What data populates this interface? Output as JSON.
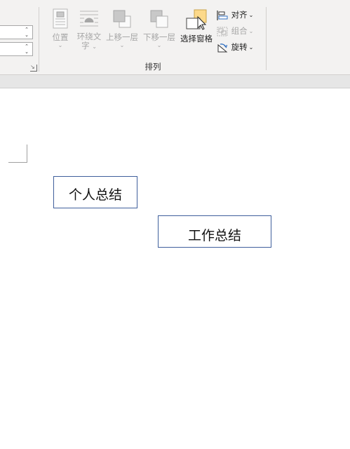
{
  "ribbon": {
    "arrange_group": {
      "label": "排列",
      "position": {
        "label": "位置"
      },
      "wrap_text": {
        "label_line1": "环绕文",
        "label_line2": "字"
      },
      "bring_forward": {
        "label": "上移一层"
      },
      "send_backward": {
        "label": "下移一层"
      },
      "selection_pane": {
        "label": "选择窗格"
      },
      "align": {
        "label": "对齐"
      },
      "group": {
        "label": "组合"
      },
      "rotate": {
        "label": "旋转"
      }
    },
    "icons": {
      "spinner_up": "chevron-up-icon",
      "spinner_down": "chevron-down-icon",
      "launcher": "dialog-launcher-icon"
    }
  },
  "document": {
    "textboxes": [
      {
        "text": "个人总结"
      },
      {
        "text": "工作总结"
      }
    ]
  }
}
